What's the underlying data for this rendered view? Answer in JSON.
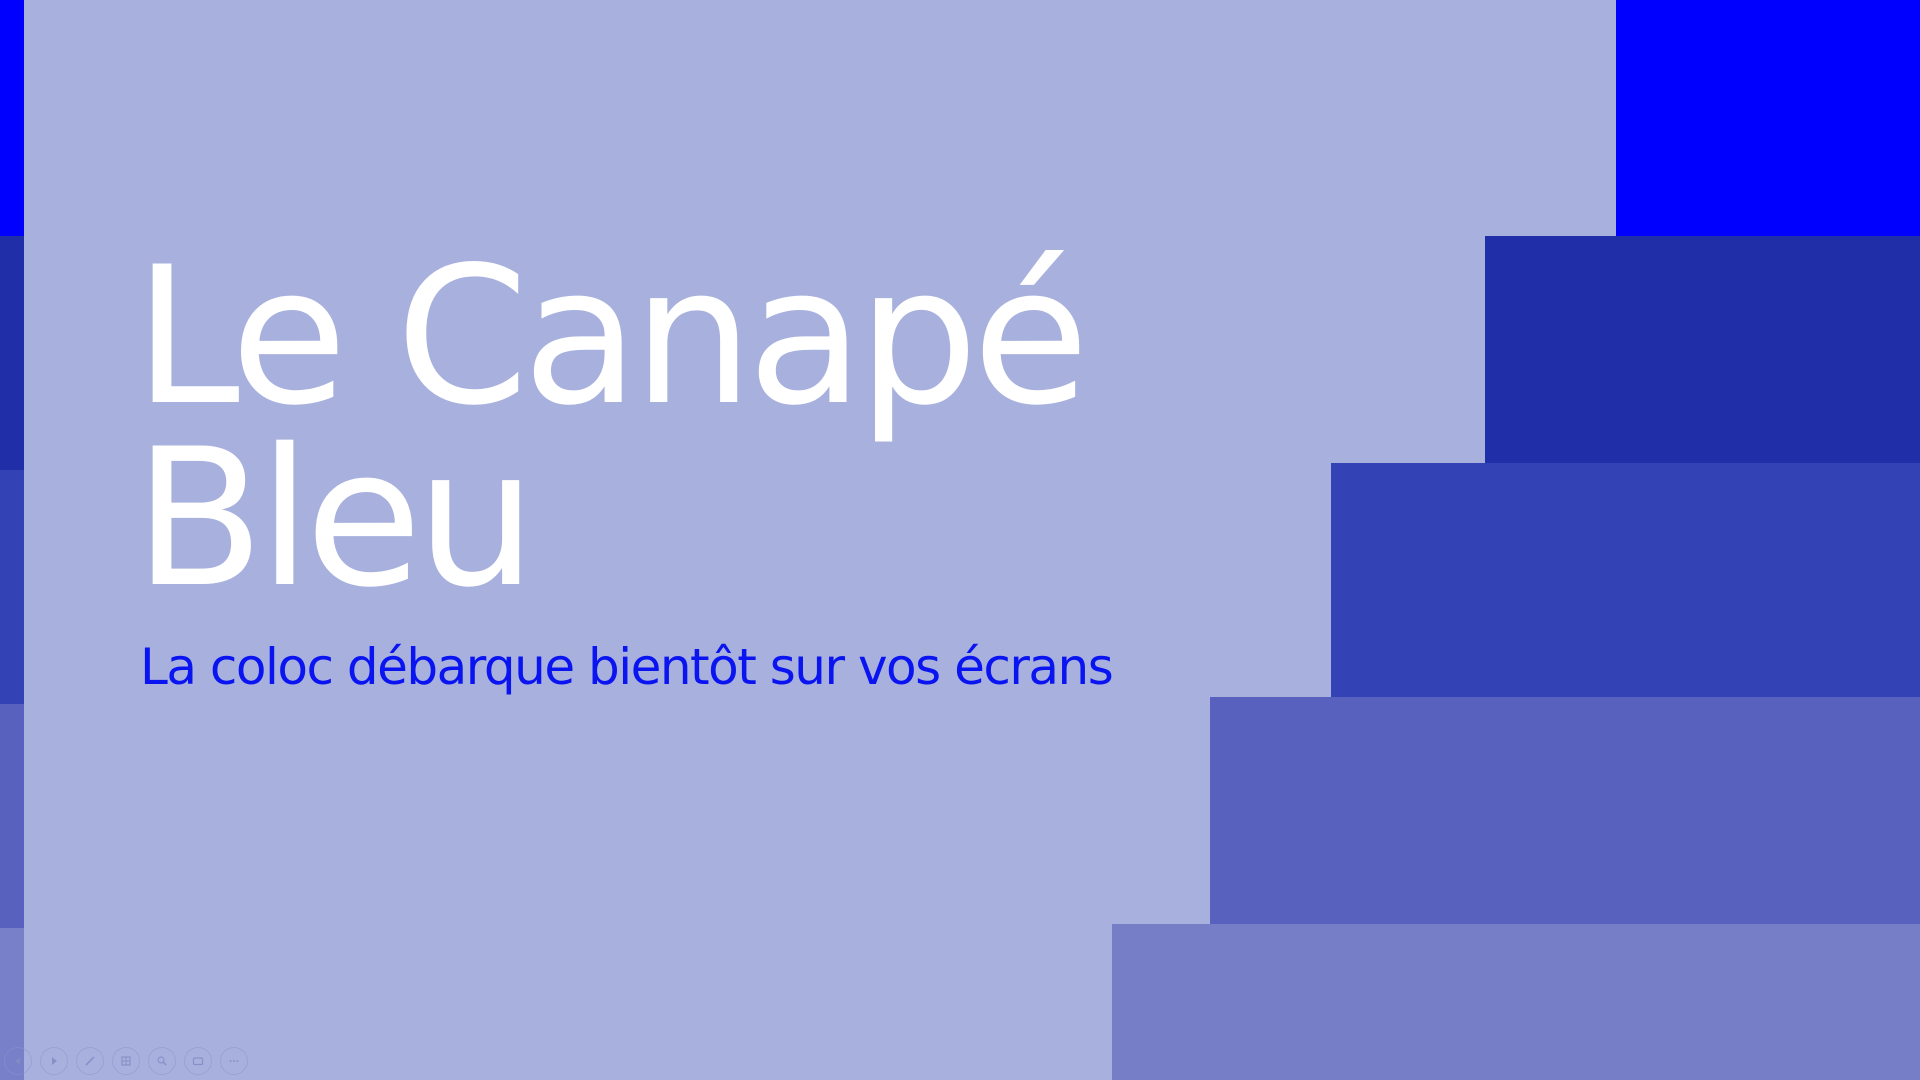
{
  "slide": {
    "title_line1": "Le Canapé",
    "title_line2": "Bleu",
    "subtitle": "La coloc débarque bientôt sur vos écrans"
  },
  "colors": {
    "background": "#a8b1de",
    "accent_blue": "#0000ff",
    "step_2": "#202ea8",
    "step_3": "#3342b4",
    "step_4": "#5862be",
    "step_5": "#767ec8",
    "title_text": "#ffffff",
    "subtitle_text": "#0a14f0"
  },
  "controls": [
    {
      "name": "previous-slide-icon"
    },
    {
      "name": "next-slide-icon"
    },
    {
      "name": "pen-icon"
    },
    {
      "name": "slides-grid-icon"
    },
    {
      "name": "zoom-icon"
    },
    {
      "name": "subtitles-icon"
    },
    {
      "name": "more-options-icon"
    }
  ]
}
